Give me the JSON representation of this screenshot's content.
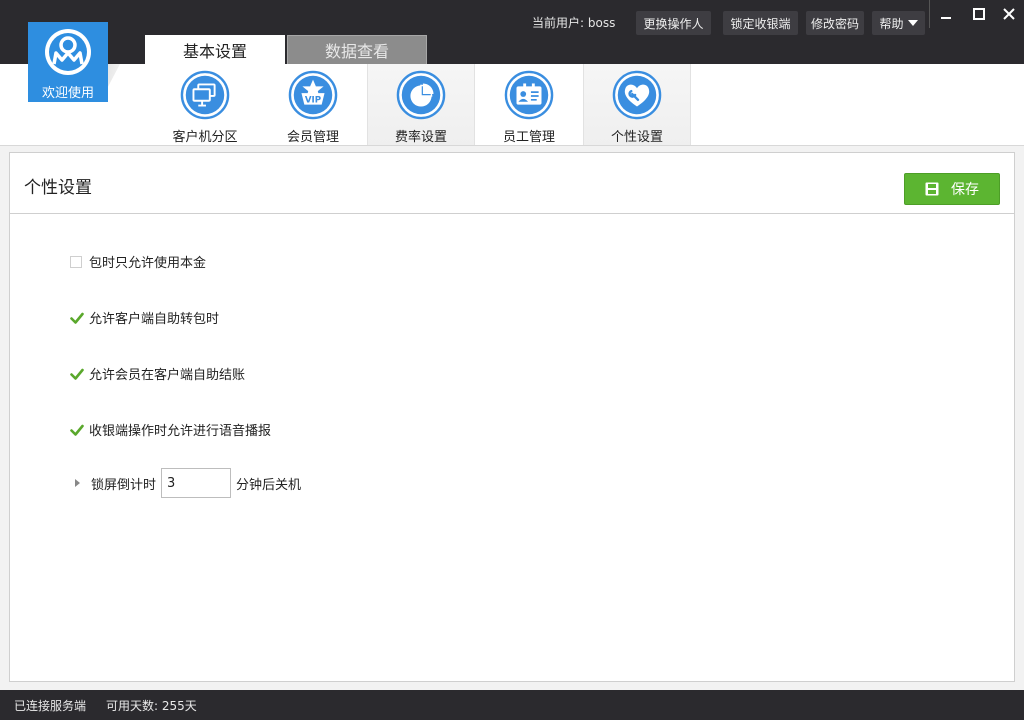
{
  "header": {
    "logo_label": "欢迎使用",
    "main_tabs": [
      {
        "label": "基本设置",
        "active": true
      },
      {
        "label": "数据查看",
        "active": false
      }
    ],
    "current_user_label": "当前用户: boss",
    "buttons": {
      "switch_operator": "更换操作人",
      "lock_cashier": "锁定收银端",
      "change_password": "修改密码",
      "help": "帮助"
    }
  },
  "toolbar": {
    "items": [
      {
        "label": "客户机分区",
        "icon": "monitor-icon"
      },
      {
        "label": "会员管理",
        "icon": "vip-icon"
      },
      {
        "label": "费率设置",
        "icon": "pie-chart-icon"
      },
      {
        "label": "员工管理",
        "icon": "id-card-icon"
      },
      {
        "label": "个性设置",
        "icon": "heart-wrench-icon"
      }
    ]
  },
  "panel": {
    "title": "个性设置",
    "save_label": "保存",
    "options": [
      {
        "label": "包时只允许使用本金",
        "checked": false
      },
      {
        "label": "允许客户端自助转包时",
        "checked": true
      },
      {
        "label": "允许会员在客户端自助结账",
        "checked": true
      },
      {
        "label": "收银端操作时允许进行语音播报",
        "checked": true
      }
    ],
    "lock_screen": {
      "label": "锁屏倒计时",
      "value": "3",
      "suffix": "分钟后关机"
    }
  },
  "status": {
    "connection": "已连接服务端",
    "days_available": "可用天数: 255天"
  },
  "colors": {
    "title_bar": "#2b2a2e",
    "accent_blue": "#2e8ee0",
    "save_green": "#5cb531",
    "check_green": "#5aa82c"
  }
}
